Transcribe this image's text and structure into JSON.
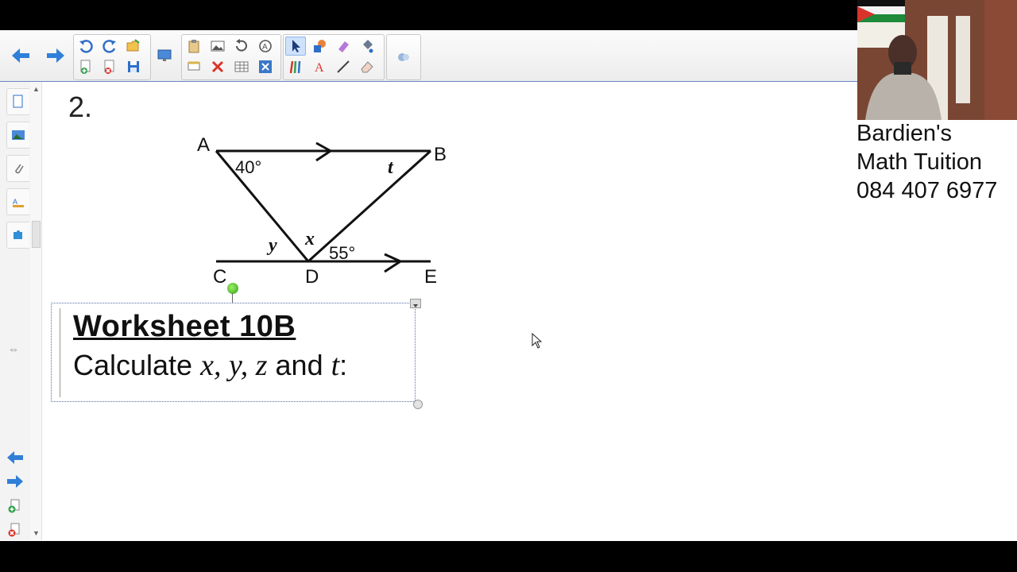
{
  "toolbar": {
    "buttons": [
      "back",
      "forward",
      "undo",
      "redo",
      "open",
      "add-page",
      "delete-page",
      "save",
      "screen-capture",
      "paste",
      "insert-picture",
      "insert-table",
      "delete",
      "select",
      "pens",
      "text",
      "line",
      "eraser",
      "fill",
      "shapes"
    ]
  },
  "sidebar": {
    "tabs": [
      "page-sorter",
      "gallery",
      "attachments",
      "properties",
      "add-ons"
    ]
  },
  "canvas": {
    "question_number": "2.",
    "diagram": {
      "labels": {
        "A": "A",
        "B": "B",
        "C": "C",
        "D": "D",
        "E": "E",
        "angle_a": "40°",
        "angle_e": "55°",
        "var_t": "t",
        "var_x": "x",
        "var_y": "y"
      }
    },
    "worksheet_title": "Worksheet 10B",
    "instruction_prefix": "Calculate ",
    "instruction_vars": "x, y, z",
    "instruction_and": " and ",
    "instruction_t": "t",
    "instruction_suffix": ":"
  },
  "tutor": {
    "line1": "Bardien's",
    "line2": "Math Tuition",
    "line3": "084 407 6977"
  },
  "colors": {
    "accent_blue": "#2f7fd8",
    "selection_border": "#5a6fa8",
    "handle_green": "#2ea10f"
  }
}
